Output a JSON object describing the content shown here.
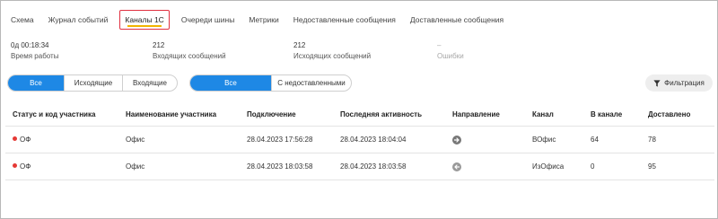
{
  "tabs": [
    {
      "label": "Схема"
    },
    {
      "label": "Журнал событий"
    },
    {
      "label": "Каналы 1С",
      "active": true
    },
    {
      "label": "Очереди шины"
    },
    {
      "label": "Метрики"
    },
    {
      "label": "Недоставленные сообщения"
    },
    {
      "label": "Доставленные сообщения"
    }
  ],
  "stats": [
    {
      "value": "0д 00:18:34",
      "label": "Время работы"
    },
    {
      "value": "212",
      "label": "Входящих сообщений"
    },
    {
      "value": "212",
      "label": "Исходящих сообщений"
    },
    {
      "value": "–",
      "label": "Ошибки"
    }
  ],
  "direction_toggle": {
    "options": [
      "Все",
      "Исходящие",
      "Входящие"
    ],
    "selected": "Все"
  },
  "status_toggle": {
    "options": [
      "Все",
      "С недоставленными"
    ],
    "selected": "Все"
  },
  "filter_button": {
    "label": "Фильтрация",
    "icon": "filter-icon"
  },
  "table": {
    "headers": [
      "Статус и код участника",
      "Наименование участника",
      "Подключение",
      "Последняя активность",
      "Направление",
      "Канал",
      "В канале",
      "Доставлено"
    ],
    "rows": [
      {
        "status_color": "#e53935",
        "code": "ОФ",
        "name": "Офис",
        "connected": "28.04.2023 17:56:28",
        "last_activity": "28.04.2023 18:04:04",
        "direction_icon": "arrow-right-circle-icon",
        "channel": "ВОфис",
        "in_channel": "64",
        "delivered": "78"
      },
      {
        "status_color": "#e53935",
        "code": "ОФ",
        "name": "Офис",
        "connected": "28.04.2023 18:03:58",
        "last_activity": "28.04.2023 18:03:58",
        "direction_icon": "arrow-left-circle-icon",
        "channel": "ИзОфиса",
        "in_channel": "0",
        "delivered": "95"
      }
    ]
  },
  "colors": {
    "accent": "#1e88e5",
    "active_tab_border": "#e03040",
    "active_tab_underline": "#f2b400",
    "status_red": "#e53935"
  }
}
